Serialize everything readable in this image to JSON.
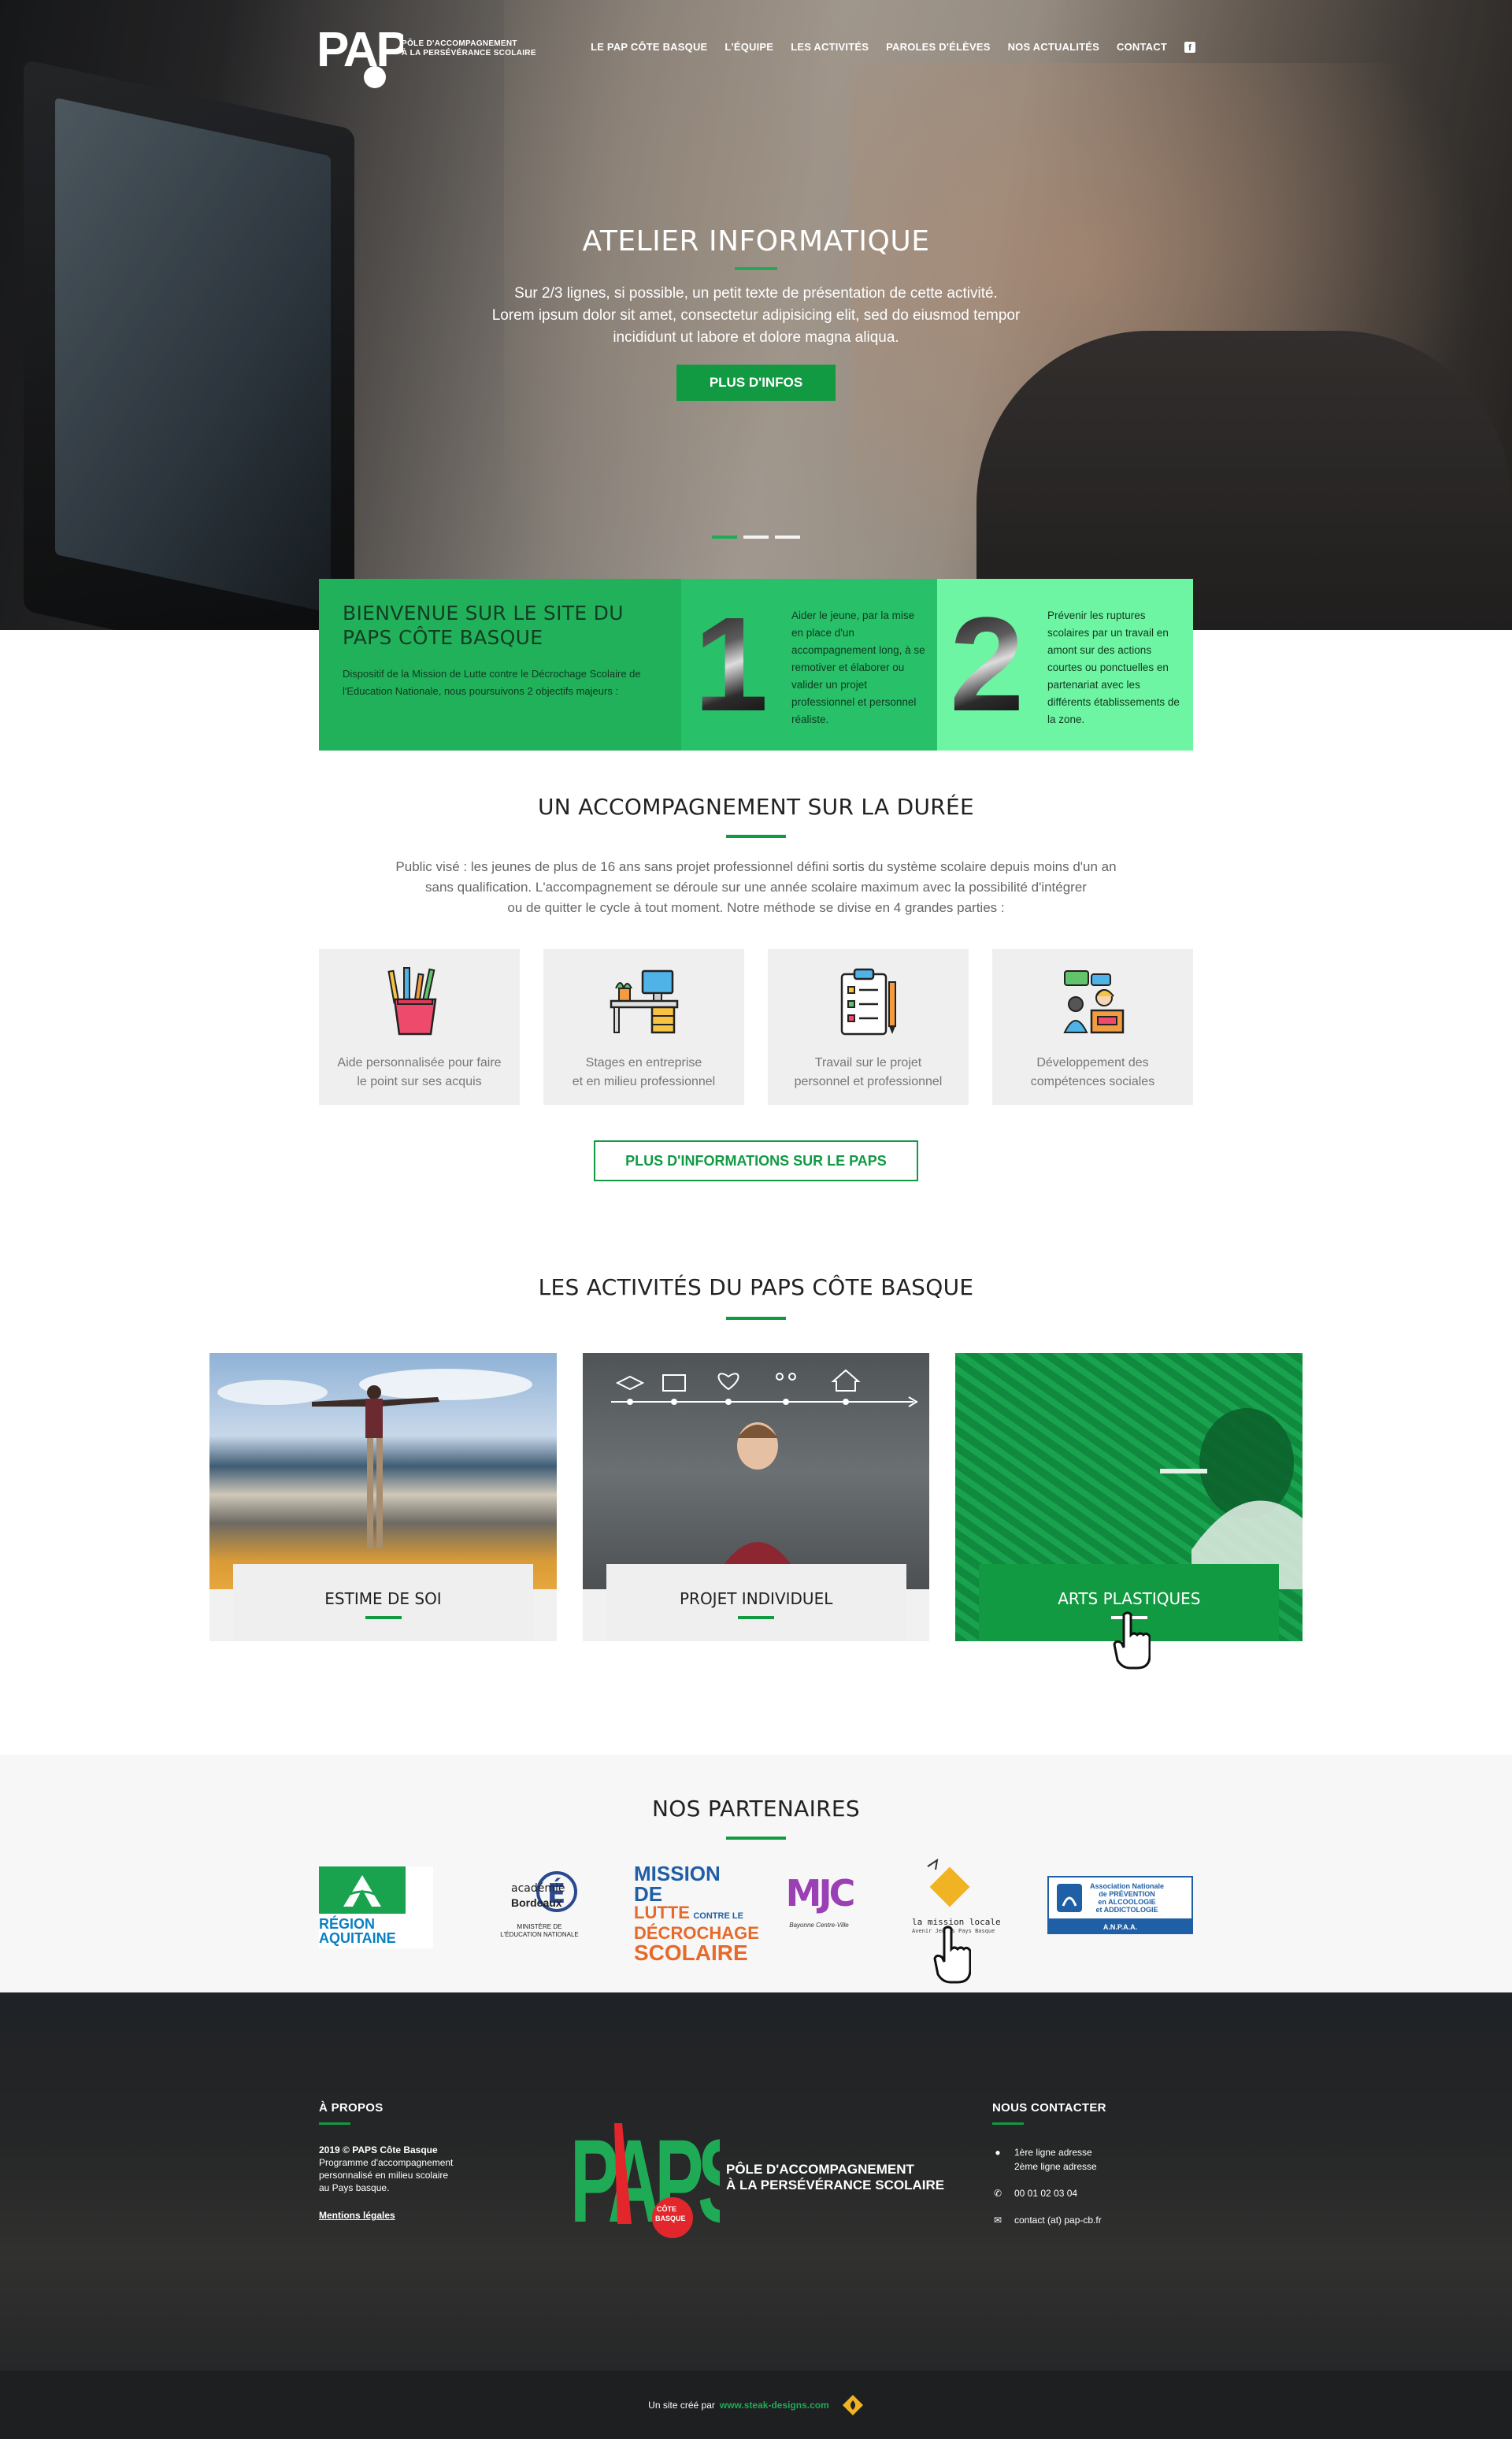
{
  "brand": {
    "logo_text": "PAPS",
    "logo_badge": "CÔTE BASQUE",
    "tagline_line1": "PÔLE D'ACCOMPAGNEMENT",
    "tagline_line2": "À LA PERSÉVÉRANCE SCOLAIRE"
  },
  "nav": {
    "items": [
      {
        "label": "LE PAP CÔTE BASQUE"
      },
      {
        "label": "L'ÉQUIPE"
      },
      {
        "label": "LES ACTIVITÉS"
      },
      {
        "label": "PAROLES D'ÉLÈVES"
      },
      {
        "label": "NOS ACTUALITÉS"
      },
      {
        "label": "CONTACT"
      }
    ],
    "facebook_icon": "f"
  },
  "hero": {
    "title": "ATELIER INFORMATIQUE",
    "text_line1": "Sur 2/3 lignes, si possible, un petit texte de présentation de cette activité.",
    "text_line2": "Lorem ipsum dolor sit amet, consectetur adipisicing elit, sed do eiusmod tempor",
    "text_line3": "incididunt ut labore et dolore magna aliqua.",
    "button": "PLUS D'INFOS",
    "slides": 3,
    "active_slide": 1
  },
  "welcome": {
    "title_line1": "BIENVENUE SUR LE SITE DU",
    "title_line2": "PAPS CÔTE BASQUE",
    "text": "Dispositif de la Mission de Lutte contre le Décrochage Scolaire de l'Education Nationale, nous poursuivons 2 objectifs majeurs :",
    "objective1_number": "1",
    "objective1_text": "Aider le jeune, par la mise en place d'un accompagnement long, à se remotiver et élaborer ou valider un projet professionnel et personnel réaliste.",
    "objective2_number": "2",
    "objective2_text": "Prévenir les ruptures scolaires par un travail en amont sur des actions courtes ou ponctuelles en partenariat avec les différents établissements de la zone."
  },
  "accompagnement": {
    "title": "UN ACCOMPAGNEMENT SUR LA DURÉE",
    "intro_line1": "Public visé : les jeunes de plus de 16 ans sans projet professionnel défini sortis du système scolaire depuis moins d'un an",
    "intro_line2": "sans qualification. L'accompagnement se déroule sur une année scolaire maximum avec la possibilité d'intégrer",
    "intro_line3": "ou de quitter le cycle à tout moment.  Notre méthode se divise en 4 grandes parties :",
    "cards": [
      {
        "icon": "pencil-cup-icon",
        "line1": "Aide personnalisée pour faire",
        "line2": "le point sur ses acquis"
      },
      {
        "icon": "desk-icon",
        "line1": "Stages en entreprise",
        "line2": "et en milieu professionnel"
      },
      {
        "icon": "clipboard-icon",
        "line1": "Travail sur le projet",
        "line2": "personnel et professionnel"
      },
      {
        "icon": "meeting-icon",
        "line1": "Développement des",
        "line2": "compétences sociales"
      }
    ],
    "button": "PLUS D'INFORMATIONS SUR LE PAPS"
  },
  "activites": {
    "title": "LES ACTIVITÉS DU PAPS CÔTE BASQUE",
    "items": [
      {
        "label": "ESTIME DE SOI"
      },
      {
        "label": "PROJET INDIVIDUEL"
      },
      {
        "label": "ARTS PLASTIQUES"
      }
    ]
  },
  "partenaires": {
    "title": "NOS PARTENAIRES",
    "region_line1": "RÉGION",
    "region_line2": "AQUITAINE",
    "academie_line1": "académie",
    "academie_line2": "Bordeaux",
    "academie_line3": "MINISTÈRE DE",
    "academie_line4": "L'ÉDUCATION NATIONALE",
    "mission_line1": "MISSION DE",
    "mission_line2": "LUTTE",
    "mission_line2b": "CONTRE LE",
    "mission_line3": "DÉCROCHAGE",
    "mission_line4": "SCOLAIRE",
    "mjc_line1": "MJC",
    "mjc_line2": "Bayonne Centre-Ville",
    "mission_locale_line1": "la mission locale",
    "mission_locale_line2": "Avenir Jeunes Pays Basque",
    "anpaa_line1": "Association Nationale",
    "anpaa_line2": "de PRÉVENTION",
    "anpaa_line3": "en ALCOOLOGIE",
    "anpaa_line4": "et ADDICTOLOGIE",
    "anpaa_line5": "A.N.P.A.A."
  },
  "footer": {
    "about_title": "À PROPOS",
    "about_line1": "2019 © PAPS Côte Basque",
    "about_line2": "Programme d'accompagnement",
    "about_line3": "personnalisé en milieu scolaire",
    "about_line4": "au Pays basque.",
    "legal": "Mentions légales",
    "contact_title": "NOUS CONTACTER",
    "address_line1": "1ère ligne adresse",
    "address_line2": "2ème ligne adresse",
    "phone": "00 01 02 03 04",
    "email": "contact (at) pap-cb.fr",
    "credit_prefix": "Un site créé par",
    "credit_link": "www.steak-designs.com"
  },
  "colors": {
    "green": "#129a43",
    "green_light": "#21b15b",
    "green_pale": "#6ef5a3",
    "red": "#e2262b"
  }
}
